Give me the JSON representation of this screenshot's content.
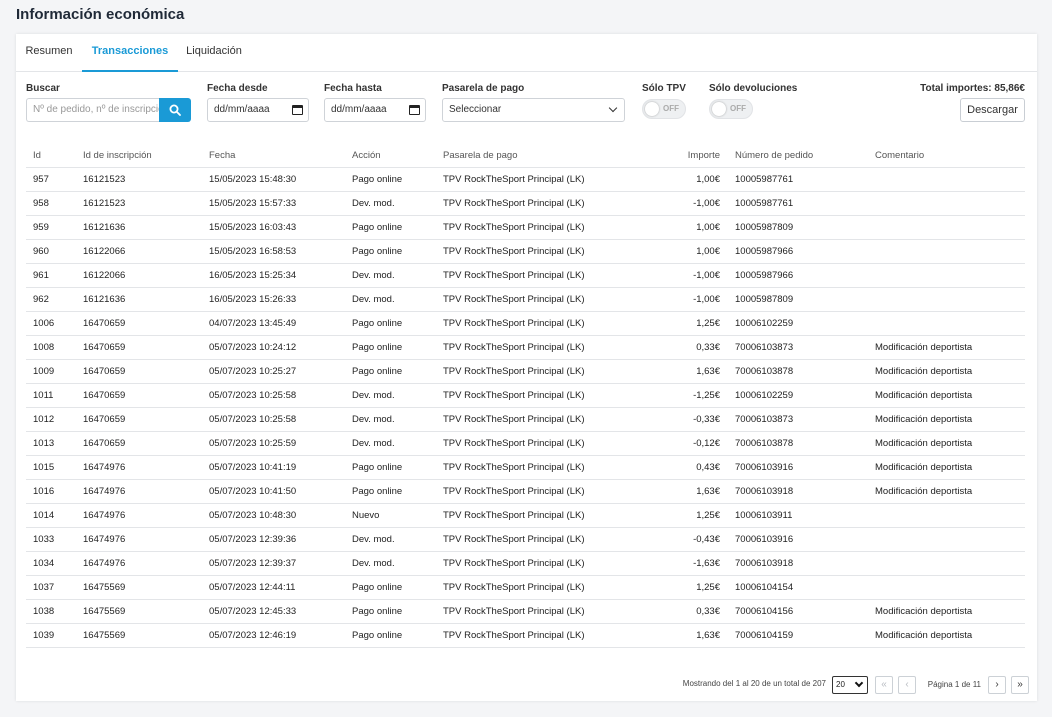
{
  "page": {
    "title": "Información económica"
  },
  "tabs": [
    {
      "label": "Resumen",
      "active": false
    },
    {
      "label": "Transacciones",
      "active": true
    },
    {
      "label": "Liquidación",
      "active": false
    }
  ],
  "filters": {
    "search": {
      "label": "Buscar",
      "placeholder": "Nº de pedido, nº de inscripción"
    },
    "date_from": {
      "label": "Fecha desde",
      "value": "dd/mm/aaaa"
    },
    "date_to": {
      "label": "Fecha hasta",
      "value": "dd/mm/aaaa"
    },
    "gateway": {
      "label": "Pasarela de pago",
      "value": "Seleccionar"
    },
    "only_tpv": {
      "label": "Sólo TPV",
      "state": "OFF"
    },
    "only_refunds": {
      "label": "Sólo devoluciones",
      "state": "OFF"
    }
  },
  "total": "Total importes: 85,86€",
  "download_label": "Descargar",
  "colors": {
    "accent": "#1a9ad6"
  },
  "table": {
    "headers": [
      "Id",
      "Id de inscripción",
      "Fecha",
      "Acción",
      "Pasarela de pago",
      "Importe",
      "Número de pedido",
      "Comentario"
    ],
    "rows": [
      [
        "957",
        "16121523",
        "15/05/2023 15:48:30",
        "Pago online",
        "TPV RockTheSport Principal (LK)",
        "1,00€",
        "10005987761",
        ""
      ],
      [
        "958",
        "16121523",
        "15/05/2023 15:57:33",
        "Dev. mod.",
        "TPV RockTheSport Principal (LK)",
        "-1,00€",
        "10005987761",
        ""
      ],
      [
        "959",
        "16121636",
        "15/05/2023 16:03:43",
        "Pago online",
        "TPV RockTheSport Principal (LK)",
        "1,00€",
        "10005987809",
        ""
      ],
      [
        "960",
        "16122066",
        "15/05/2023 16:58:53",
        "Pago online",
        "TPV RockTheSport Principal (LK)",
        "1,00€",
        "10005987966",
        ""
      ],
      [
        "961",
        "16122066",
        "16/05/2023 15:25:34",
        "Dev. mod.",
        "TPV RockTheSport Principal (LK)",
        "-1,00€",
        "10005987966",
        ""
      ],
      [
        "962",
        "16121636",
        "16/05/2023 15:26:33",
        "Dev. mod.",
        "TPV RockTheSport Principal (LK)",
        "-1,00€",
        "10005987809",
        ""
      ],
      [
        "1006",
        "16470659",
        "04/07/2023 13:45:49",
        "Pago online",
        "TPV RockTheSport Principal (LK)",
        "1,25€",
        "10006102259",
        ""
      ],
      [
        "1008",
        "16470659",
        "05/07/2023 10:24:12",
        "Pago online",
        "TPV RockTheSport Principal (LK)",
        "0,33€",
        "70006103873",
        "Modificación deportista"
      ],
      [
        "1009",
        "16470659",
        "05/07/2023 10:25:27",
        "Pago online",
        "TPV RockTheSport Principal (LK)",
        "1,63€",
        "70006103878",
        "Modificación deportista"
      ],
      [
        "1011",
        "16470659",
        "05/07/2023 10:25:58",
        "Dev. mod.",
        "TPV RockTheSport Principal (LK)",
        "-1,25€",
        "10006102259",
        "Modificación deportista"
      ],
      [
        "1012",
        "16470659",
        "05/07/2023 10:25:58",
        "Dev. mod.",
        "TPV RockTheSport Principal (LK)",
        "-0,33€",
        "70006103873",
        "Modificación deportista"
      ],
      [
        "1013",
        "16470659",
        "05/07/2023 10:25:59",
        "Dev. mod.",
        "TPV RockTheSport Principal (LK)",
        "-0,12€",
        "70006103878",
        "Modificación deportista"
      ],
      [
        "1015",
        "16474976",
        "05/07/2023 10:41:19",
        "Pago online",
        "TPV RockTheSport Principal (LK)",
        "0,43€",
        "70006103916",
        "Modificación deportista"
      ],
      [
        "1016",
        "16474976",
        "05/07/2023 10:41:50",
        "Pago online",
        "TPV RockTheSport Principal (LK)",
        "1,63€",
        "70006103918",
        "Modificación deportista"
      ],
      [
        "1014",
        "16474976",
        "05/07/2023 10:48:30",
        "Nuevo",
        "TPV RockTheSport Principal (LK)",
        "1,25€",
        "10006103911",
        ""
      ],
      [
        "1033",
        "16474976",
        "05/07/2023 12:39:36",
        "Dev. mod.",
        "TPV RockTheSport Principal (LK)",
        "-0,43€",
        "70006103916",
        ""
      ],
      [
        "1034",
        "16474976",
        "05/07/2023 12:39:37",
        "Dev. mod.",
        "TPV RockTheSport Principal (LK)",
        "-1,63€",
        "70006103918",
        ""
      ],
      [
        "1037",
        "16475569",
        "05/07/2023 12:44:11",
        "Pago online",
        "TPV RockTheSport Principal (LK)",
        "1,25€",
        "10006104154",
        ""
      ],
      [
        "1038",
        "16475569",
        "05/07/2023 12:45:33",
        "Pago online",
        "TPV RockTheSport Principal (LK)",
        "0,33€",
        "70006104156",
        "Modificación deportista"
      ],
      [
        "1039",
        "16475569",
        "05/07/2023 12:46:19",
        "Pago online",
        "TPV RockTheSport Principal (LK)",
        "1,63€",
        "70006104159",
        "Modificación deportista"
      ]
    ]
  },
  "pagination": {
    "summary": "Mostrando del 1 al 20 de un total de 207",
    "page_size": "20",
    "page_info": "Página 1 de 11",
    "first": "«",
    "prev": "‹",
    "next": "›",
    "last": "»"
  }
}
